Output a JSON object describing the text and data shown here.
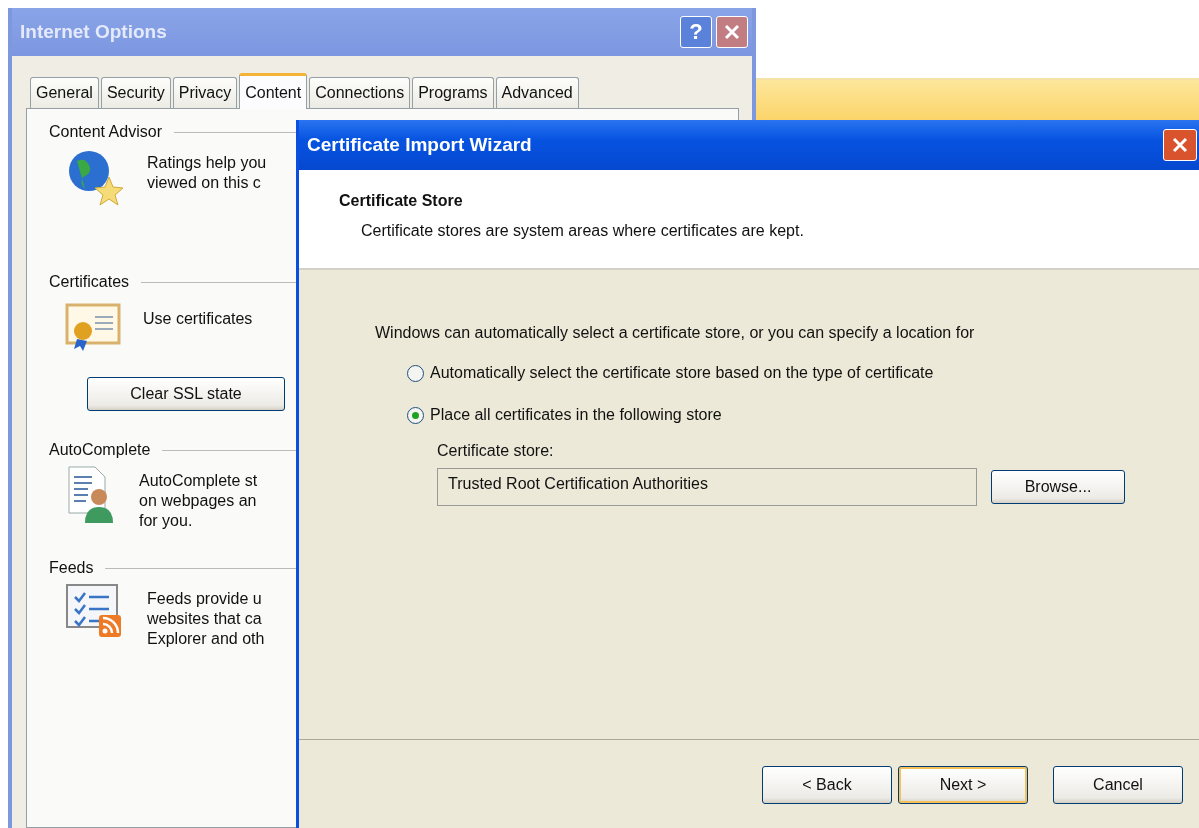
{
  "internet_options": {
    "title": "Internet Options",
    "help_button": "?",
    "tabs": [
      {
        "label": "General",
        "selected": false
      },
      {
        "label": "Security",
        "selected": false
      },
      {
        "label": "Privacy",
        "selected": false
      },
      {
        "label": "Content",
        "selected": true
      },
      {
        "label": "Connections",
        "selected": false
      },
      {
        "label": "Programs",
        "selected": false
      },
      {
        "label": "Advanced",
        "selected": false
      }
    ],
    "sections": [
      {
        "heading": "Content Advisor",
        "kind": "globe",
        "lines": [
          "Ratings help you",
          "viewed on this c"
        ]
      },
      {
        "heading": "Certificates",
        "kind": "certificate",
        "lines": [
          "Use certificates"
        ],
        "button": "Clear SSL state"
      },
      {
        "heading": "AutoComplete",
        "kind": "autocomplete",
        "lines": [
          "AutoComplete st",
          "on webpages an",
          "for you."
        ]
      },
      {
        "heading": "Feeds",
        "kind": "feeds",
        "lines": [
          "Feeds provide u",
          "websites that ca",
          "Explorer and oth"
        ]
      }
    ]
  },
  "wizard": {
    "title": "Certificate Import Wizard",
    "heading": "Certificate Store",
    "subtitle": "Certificate stores are system areas where certificates are kept.",
    "intro": "Windows can automatically select a certificate store, or you can specify a location for",
    "options": [
      {
        "label": "Automatically select the certificate store based on the type of certificate",
        "selected": false
      },
      {
        "label": "Place all certificates in the following store",
        "selected": true
      }
    ],
    "store_label": "Certificate store:",
    "store_value": "Trusted Root Certification Authorities",
    "browse_button": "Browse...",
    "buttons": [
      {
        "label": "< Back",
        "default": false
      },
      {
        "label": "Next >",
        "default": true
      },
      {
        "label": "Cancel",
        "default": false
      }
    ]
  }
}
